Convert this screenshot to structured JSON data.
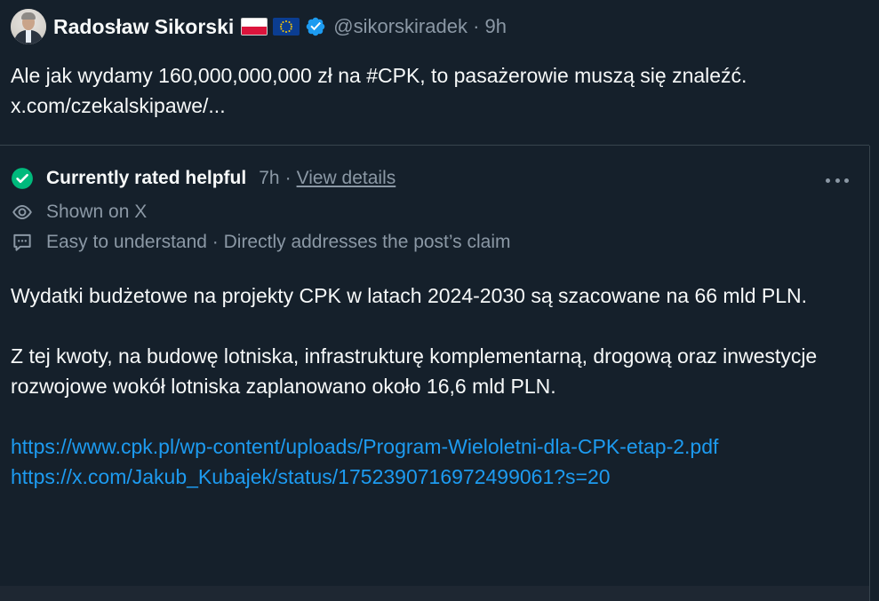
{
  "post": {
    "author_name": "Radosław Sikorski",
    "handle": "@sikorskiradek",
    "separator": "·",
    "time": "9h",
    "text": "Ale jak wydamy 160,000,000,000 zł na #CPK, to pasażerowie muszą się znaleźć. x.com/czekalskipawe/...",
    "icons": [
      "avatar",
      "poland-flag-icon",
      "eu-flag-icon",
      "verified-badge-icon"
    ],
    "colors": {
      "background": "#15202b",
      "verified": "#1d9bf0",
      "poland_red": "#dc143c",
      "eu_blue": "#0b3d91"
    }
  },
  "community_note": {
    "status": "Currently rated helpful",
    "time": "7h",
    "separator": "·",
    "view_details": "View details",
    "shown_on": "Shown on X",
    "reasons": "Easy to understand · Directly addresses the post’s claim",
    "body_p1": "Wydatki budżetowe na projekty CPK w latach 2024-2030 są szacowane na 66 mld PLN.",
    "body_p2": "Z tej kwoty, na budowę lotniska, infrastrukturę komplementarną, drogową oraz inwestycje rozwojowe wokół lotniska zaplanowano około 16,6 mld PLN.",
    "link1": "https://www.cpk.pl/wp-content/uploads/Program-Wieloletni-dla-CPK-etap-2.pdf",
    "link2": "https://x.com/Jakub_Kubajek/status/1752390716972499061?s=20",
    "icons": [
      "check-circle-icon",
      "eye-icon",
      "chat-bubble-icon",
      "more-options-icon"
    ],
    "colors": {
      "check": "#00ba7c",
      "muted": "#8b98a5",
      "link": "#1d9bf0"
    }
  }
}
